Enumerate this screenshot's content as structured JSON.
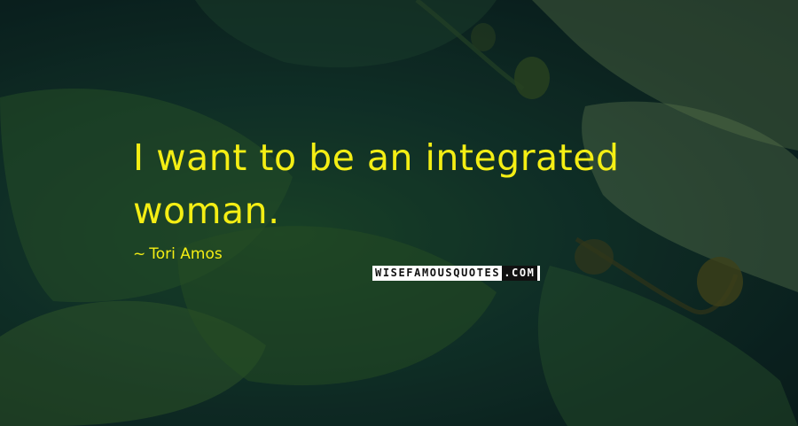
{
  "quote": {
    "line1": "I want to be an integrated",
    "line2": "woman."
  },
  "author": {
    "dash": "~",
    "name": "Tori Amos"
  },
  "watermark": {
    "text_main": "WISEFAMOUSQUOTES",
    "text_suffix": ".COM"
  },
  "colors": {
    "text": "#f4ee14",
    "background": "#12342a"
  }
}
